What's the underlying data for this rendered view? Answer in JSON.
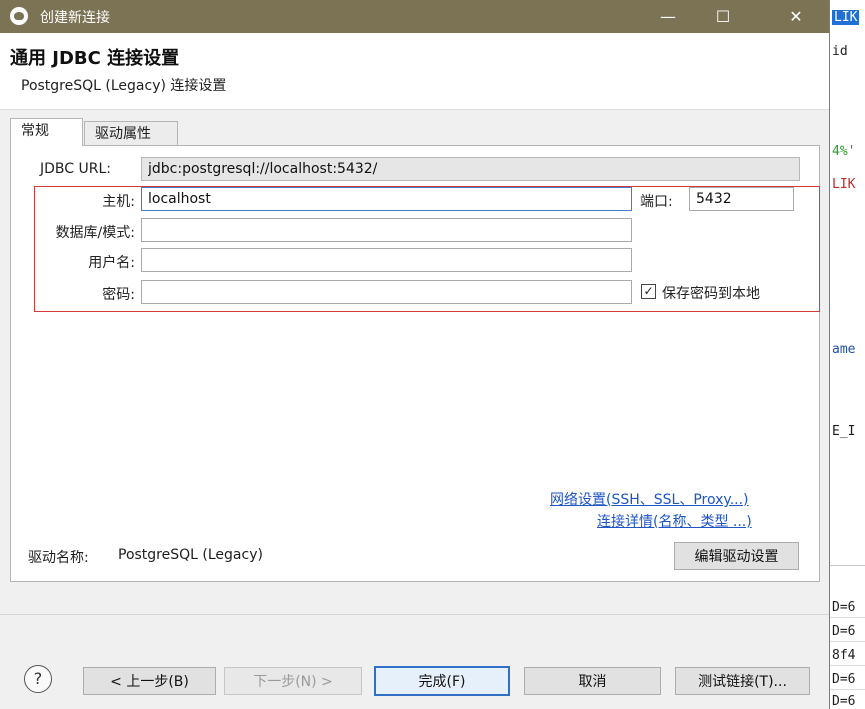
{
  "window": {
    "title": "创建新连接",
    "minimize": "—",
    "maximize": "☐",
    "close": "✕"
  },
  "header": {
    "title": "通用 JDBC 连接设置",
    "subtitle": "PostgreSQL (Legacy) 连接设置"
  },
  "tabs": [
    {
      "label": "常规",
      "active": true
    },
    {
      "label": "驱动属性",
      "active": false
    }
  ],
  "form": {
    "jdbc_url_label": "JDBC URL:",
    "jdbc_url_value": "jdbc:postgresql://localhost:5432/",
    "host_label": "主机:",
    "host_value": "localhost",
    "port_label": "端口:",
    "port_value": "5432",
    "database_label": "数据库/模式:",
    "database_value": "",
    "username_label": "用户名:",
    "username_value": "",
    "password_label": "密码:",
    "password_value": "",
    "save_password_label": "保存密码到本地",
    "save_password_checked": true,
    "check_mark": "✓"
  },
  "links": {
    "network": "网络设置(SSH、SSL、Proxy...)",
    "details": "连接详情(名称、类型 ...)"
  },
  "driver": {
    "label": "驱动名称:",
    "value": "PostgreSQL (Legacy)",
    "edit_button": "编辑驱动设置"
  },
  "footer": {
    "help_icon": "?",
    "back": "< 上一步(B)",
    "next": "下一步(N) >",
    "finish": "完成(F)",
    "cancel": "取消",
    "test": "测试链接(T)..."
  },
  "background_editor": {
    "lines": [
      "LIK",
      "id",
      "4%'",
      "LIK",
      "ame",
      "E_I"
    ],
    "results": [
      "D=6",
      "D=6",
      "8f4",
      "D=6",
      "D=6"
    ]
  }
}
